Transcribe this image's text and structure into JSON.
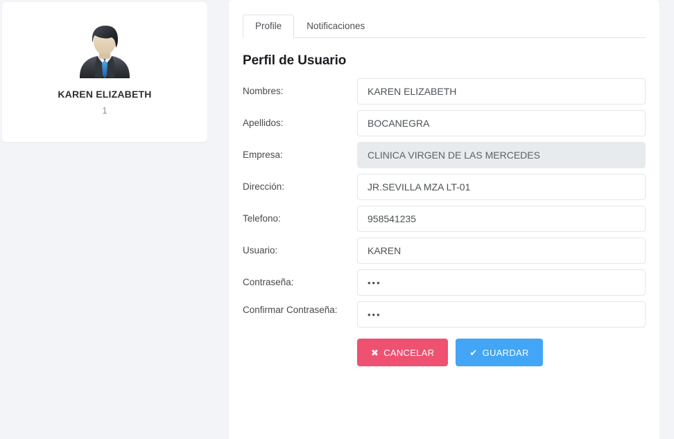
{
  "theme": {
    "page_background": "#f3f4f7",
    "card_background": "#ffffff",
    "cancel_color": "#ef5170",
    "save_color": "#42a5f5",
    "disabled_field_background": "#e8ebed",
    "border_color": "#dee2e6"
  },
  "profile_card": {
    "avatar_icon": "businessman-avatar-icon",
    "name": "KAREN ELIZABETH",
    "subtitle": "1"
  },
  "tabs": [
    {
      "label": "Profile",
      "active": true
    },
    {
      "label": "Notificaciones",
      "active": false
    }
  ],
  "main": {
    "title": "Perfil de Usuario",
    "fields": [
      {
        "label": "Nombres:",
        "value": "KAREN ELIZABETH",
        "placeholder": "Nombres",
        "disabled": false,
        "type": "text"
      },
      {
        "label": "Apellidos:",
        "value": "BOCANEGRA",
        "placeholder": "Apellidos",
        "disabled": false,
        "type": "text"
      },
      {
        "label": "Empresa:",
        "value": "CLINICA VIRGEN DE LAS MERCEDES",
        "placeholder": "Empresa",
        "disabled": true,
        "type": "text"
      },
      {
        "label": "Dirección:",
        "value": "JR.SEVILLA MZA LT-01",
        "placeholder": "Dirección",
        "disabled": false,
        "type": "text"
      },
      {
        "label": "Telefono:",
        "value": "958541235",
        "placeholder": "Telefono",
        "disabled": false,
        "type": "text"
      },
      {
        "label": "Usuario:",
        "value": "KAREN",
        "placeholder": "Usuario",
        "disabled": false,
        "type": "text"
      },
      {
        "label": "Contraseña:",
        "value": "•••",
        "placeholder": "Contraseña",
        "disabled": false,
        "type": "password"
      },
      {
        "label": "Confirmar Contraseña:",
        "value": "•••",
        "placeholder": "Confirmar Contraseña",
        "disabled": false,
        "type": "password"
      }
    ],
    "buttons": {
      "cancel": {
        "label": "CANCELAR",
        "icon": "close-icon",
        "glyph": "✖"
      },
      "save": {
        "label": "GUARDAR",
        "icon": "check-icon",
        "glyph": "✔"
      }
    }
  }
}
